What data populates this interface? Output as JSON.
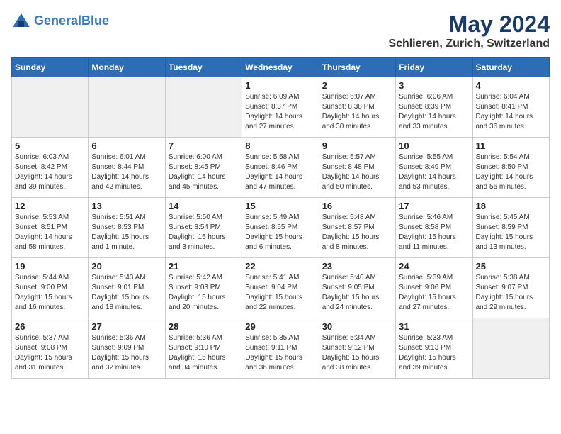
{
  "logo": {
    "line1": "General",
    "line2": "Blue"
  },
  "title": "May 2024",
  "location": "Schlieren, Zurich, Switzerland",
  "days_of_week": [
    "Sunday",
    "Monday",
    "Tuesday",
    "Wednesday",
    "Thursday",
    "Friday",
    "Saturday"
  ],
  "weeks": [
    [
      {
        "day": "",
        "info": ""
      },
      {
        "day": "",
        "info": ""
      },
      {
        "day": "",
        "info": ""
      },
      {
        "day": "1",
        "info": "Sunrise: 6:09 AM\nSunset: 8:37 PM\nDaylight: 14 hours\nand 27 minutes."
      },
      {
        "day": "2",
        "info": "Sunrise: 6:07 AM\nSunset: 8:38 PM\nDaylight: 14 hours\nand 30 minutes."
      },
      {
        "day": "3",
        "info": "Sunrise: 6:06 AM\nSunset: 8:39 PM\nDaylight: 14 hours\nand 33 minutes."
      },
      {
        "day": "4",
        "info": "Sunrise: 6:04 AM\nSunset: 8:41 PM\nDaylight: 14 hours\nand 36 minutes."
      }
    ],
    [
      {
        "day": "5",
        "info": "Sunrise: 6:03 AM\nSunset: 8:42 PM\nDaylight: 14 hours\nand 39 minutes."
      },
      {
        "day": "6",
        "info": "Sunrise: 6:01 AM\nSunset: 8:44 PM\nDaylight: 14 hours\nand 42 minutes."
      },
      {
        "day": "7",
        "info": "Sunrise: 6:00 AM\nSunset: 8:45 PM\nDaylight: 14 hours\nand 45 minutes."
      },
      {
        "day": "8",
        "info": "Sunrise: 5:58 AM\nSunset: 8:46 PM\nDaylight: 14 hours\nand 47 minutes."
      },
      {
        "day": "9",
        "info": "Sunrise: 5:57 AM\nSunset: 8:48 PM\nDaylight: 14 hours\nand 50 minutes."
      },
      {
        "day": "10",
        "info": "Sunrise: 5:55 AM\nSunset: 8:49 PM\nDaylight: 14 hours\nand 53 minutes."
      },
      {
        "day": "11",
        "info": "Sunrise: 5:54 AM\nSunset: 8:50 PM\nDaylight: 14 hours\nand 56 minutes."
      }
    ],
    [
      {
        "day": "12",
        "info": "Sunrise: 5:53 AM\nSunset: 8:51 PM\nDaylight: 14 hours\nand 58 minutes."
      },
      {
        "day": "13",
        "info": "Sunrise: 5:51 AM\nSunset: 8:53 PM\nDaylight: 15 hours\nand 1 minute."
      },
      {
        "day": "14",
        "info": "Sunrise: 5:50 AM\nSunset: 8:54 PM\nDaylight: 15 hours\nand 3 minutes."
      },
      {
        "day": "15",
        "info": "Sunrise: 5:49 AM\nSunset: 8:55 PM\nDaylight: 15 hours\nand 6 minutes."
      },
      {
        "day": "16",
        "info": "Sunrise: 5:48 AM\nSunset: 8:57 PM\nDaylight: 15 hours\nand 8 minutes."
      },
      {
        "day": "17",
        "info": "Sunrise: 5:46 AM\nSunset: 8:58 PM\nDaylight: 15 hours\nand 11 minutes."
      },
      {
        "day": "18",
        "info": "Sunrise: 5:45 AM\nSunset: 8:59 PM\nDaylight: 15 hours\nand 13 minutes."
      }
    ],
    [
      {
        "day": "19",
        "info": "Sunrise: 5:44 AM\nSunset: 9:00 PM\nDaylight: 15 hours\nand 16 minutes."
      },
      {
        "day": "20",
        "info": "Sunrise: 5:43 AM\nSunset: 9:01 PM\nDaylight: 15 hours\nand 18 minutes."
      },
      {
        "day": "21",
        "info": "Sunrise: 5:42 AM\nSunset: 9:03 PM\nDaylight: 15 hours\nand 20 minutes."
      },
      {
        "day": "22",
        "info": "Sunrise: 5:41 AM\nSunset: 9:04 PM\nDaylight: 15 hours\nand 22 minutes."
      },
      {
        "day": "23",
        "info": "Sunrise: 5:40 AM\nSunset: 9:05 PM\nDaylight: 15 hours\nand 24 minutes."
      },
      {
        "day": "24",
        "info": "Sunrise: 5:39 AM\nSunset: 9:06 PM\nDaylight: 15 hours\nand 27 minutes."
      },
      {
        "day": "25",
        "info": "Sunrise: 5:38 AM\nSunset: 9:07 PM\nDaylight: 15 hours\nand 29 minutes."
      }
    ],
    [
      {
        "day": "26",
        "info": "Sunrise: 5:37 AM\nSunset: 9:08 PM\nDaylight: 15 hours\nand 31 minutes."
      },
      {
        "day": "27",
        "info": "Sunrise: 5:36 AM\nSunset: 9:09 PM\nDaylight: 15 hours\nand 32 minutes."
      },
      {
        "day": "28",
        "info": "Sunrise: 5:36 AM\nSunset: 9:10 PM\nDaylight: 15 hours\nand 34 minutes."
      },
      {
        "day": "29",
        "info": "Sunrise: 5:35 AM\nSunset: 9:11 PM\nDaylight: 15 hours\nand 36 minutes."
      },
      {
        "day": "30",
        "info": "Sunrise: 5:34 AM\nSunset: 9:12 PM\nDaylight: 15 hours\nand 38 minutes."
      },
      {
        "day": "31",
        "info": "Sunrise: 5:33 AM\nSunset: 9:13 PM\nDaylight: 15 hours\nand 39 minutes."
      },
      {
        "day": "",
        "info": ""
      }
    ]
  ]
}
